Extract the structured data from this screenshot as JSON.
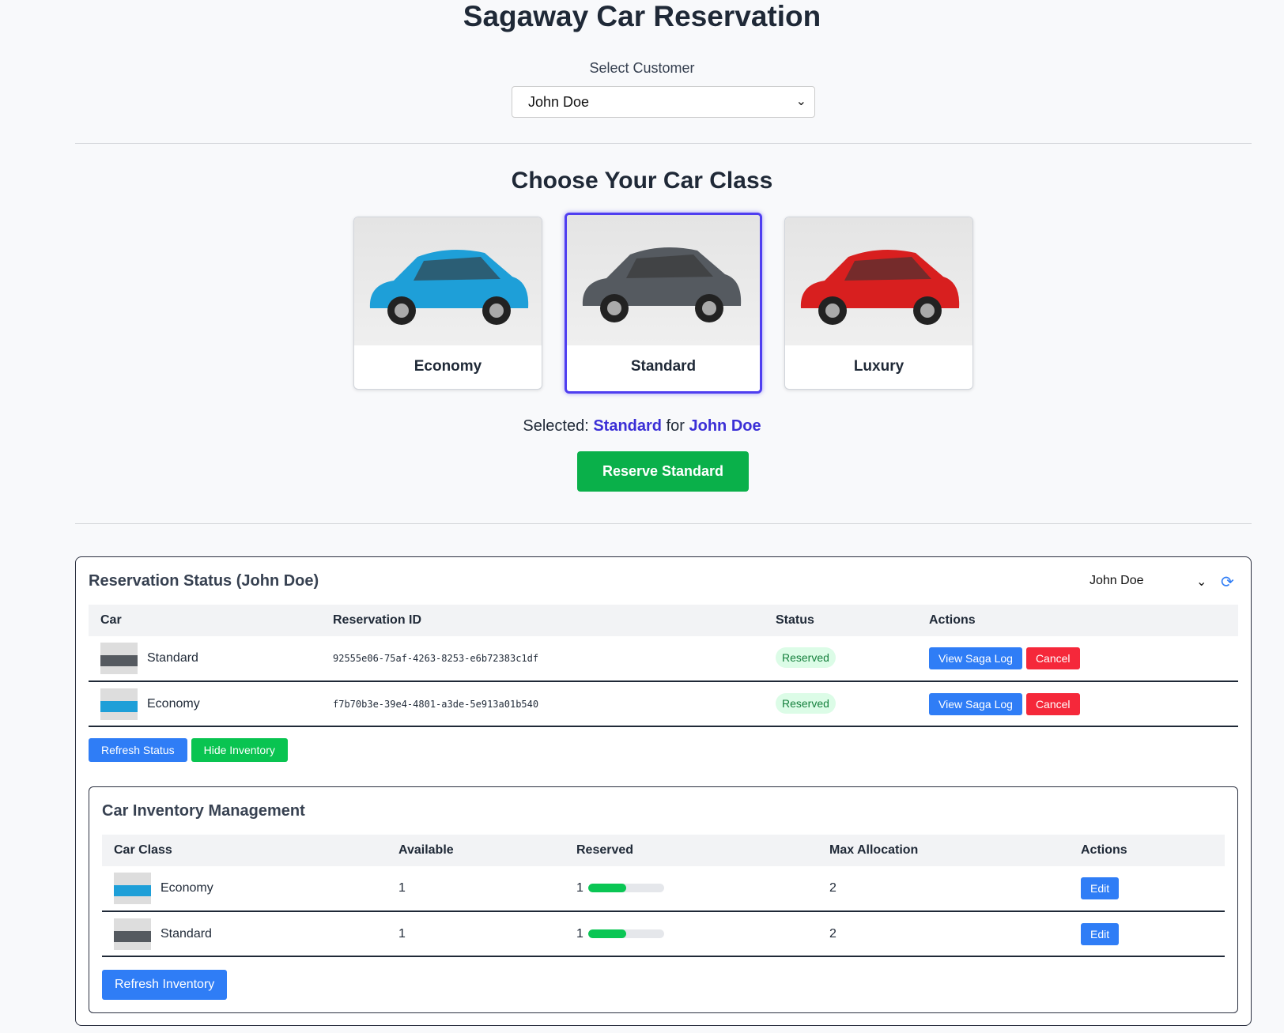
{
  "title": "Sagaway Car Reservation",
  "customer": {
    "label": "Select Customer",
    "value": "John Doe"
  },
  "classes": {
    "heading": "Choose Your Car Class",
    "items": [
      {
        "name": "Economy",
        "color": "#1e9fd8"
      },
      {
        "name": "Standard",
        "color": "#555a60"
      },
      {
        "name": "Luxury",
        "color": "#d81f1f"
      }
    ],
    "selected": "Standard"
  },
  "selection": {
    "prefix": "Selected:",
    "car": "Standard",
    "mid": "for",
    "customer": "John Doe"
  },
  "reserve_label": "Reserve Standard",
  "status": {
    "title": "Reservation Status (John Doe)",
    "customer": "John Doe",
    "headers": [
      "Car",
      "Reservation ID",
      "Status",
      "Actions"
    ],
    "rows": [
      {
        "car": "Standard",
        "id": "92555e06-75af-4263-8253-e6b72383c1df",
        "status": "Reserved"
      },
      {
        "car": "Economy",
        "id": "f7b70b3e-39e4-4801-a3de-5e913a01b540",
        "status": "Reserved"
      }
    ],
    "view_label": "View Saga Log",
    "cancel_label": "Cancel",
    "refresh_label": "Refresh Status",
    "hide_label": "Hide Inventory"
  },
  "inventory": {
    "title": "Car Inventory Management",
    "headers": [
      "Car Class",
      "Available",
      "Reserved",
      "Max Allocation",
      "Actions"
    ],
    "rows": [
      {
        "car": "Economy",
        "available": "1",
        "reserved": "1",
        "max": "2",
        "reserved_fraction": 0.5
      },
      {
        "car": "Standard",
        "available": "1",
        "reserved": "1",
        "max": "2",
        "reserved_fraction": 0.5
      }
    ],
    "edit_label": "Edit",
    "refresh_label": "Refresh Inventory"
  }
}
